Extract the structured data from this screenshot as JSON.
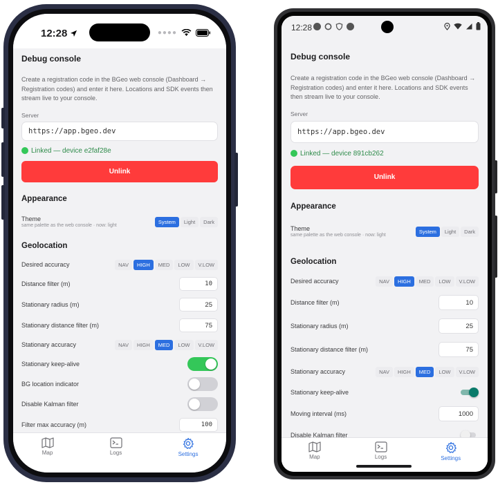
{
  "colors": {
    "accent": "#2c6fe0",
    "danger": "#ff3b3b",
    "success": "#34c759",
    "teal": "#0a7a6a"
  },
  "iphone": {
    "status_time": "12:28",
    "header": "Debug console",
    "description": "Create a registration code in the BGeo web console (Dashboard → Registration codes) and enter it here. Locations and SDK events then stream live to your console.",
    "server_label": "Server",
    "server_value": "https://app.bgeo.dev",
    "linked_text": "Linked — device e2faf28e",
    "unlink_label": "Unlink",
    "appearance_title": "Appearance",
    "theme_label": "Theme",
    "theme_sub": "same palette as the web console · now: light",
    "theme_options": [
      "System",
      "Light",
      "Dark"
    ],
    "theme_selected": 0,
    "geolocation_title": "Geolocation",
    "desired_accuracy_label": "Desired accuracy",
    "accuracy_options": [
      "NAV",
      "HIGH",
      "MED",
      "LOW",
      "V.LOW"
    ],
    "desired_accuracy_selected": 1,
    "distance_filter_label": "Distance filter (m)",
    "distance_filter_value": "10",
    "stationary_radius_label": "Stationary radius (m)",
    "stationary_radius_value": "25",
    "stationary_distance_label": "Stationary distance filter (m)",
    "stationary_distance_value": "75",
    "stationary_accuracy_label": "Stationary accuracy",
    "stationary_accuracy_selected": 2,
    "keepalive_label": "Stationary keep-alive",
    "keepalive_on": true,
    "bg_indicator_label": "BG location indicator",
    "bg_indicator_on": false,
    "kalman_label": "Disable Kalman filter",
    "kalman_on": false,
    "filter_max_label": "Filter max accuracy (m)",
    "filter_max_value": "100",
    "tabs": [
      {
        "label": "Map",
        "icon": "map-icon"
      },
      {
        "label": "Logs",
        "icon": "terminal-icon"
      },
      {
        "label": "Settings",
        "icon": "gear-icon"
      }
    ]
  },
  "android": {
    "status_time": "12:28",
    "header": "Debug console",
    "description": "Create a registration code in the BGeo web console (Dashboard → Registration codes) and enter it here. Locations and SDK events then stream live to your console.",
    "server_label": "Server",
    "server_value": "https://app.bgeo.dev",
    "linked_text": "Linked — device 891cb262",
    "unlink_label": "Unlink",
    "appearance_title": "Appearance",
    "theme_label": "Theme",
    "theme_sub": "same palette as the web console · now: light",
    "theme_options": [
      "System",
      "Light",
      "Dark"
    ],
    "geolocation_title": "Geolocation",
    "desired_accuracy_label": "Desired accuracy",
    "accuracy_options": [
      "NAV",
      "HIGH",
      "MED",
      "LOW",
      "V.LOW"
    ],
    "distance_filter_label": "Distance filter (m)",
    "distance_filter_value": "10",
    "stationary_radius_label": "Stationary radius (m)",
    "stationary_radius_value": "25",
    "stationary_distance_label": "Stationary distance filter (m)",
    "stationary_distance_value": "75",
    "stationary_accuracy_label": "Stationary accuracy",
    "keepalive_label": "Stationary keep-alive",
    "keepalive_on": true,
    "moving_interval_label": "Moving interval (ms)",
    "moving_interval_value": "1000",
    "kalman_label": "Disable Kalman filter",
    "kalman_on": false,
    "tabs": [
      {
        "label": "Map",
        "icon": "map-icon"
      },
      {
        "label": "Logs",
        "icon": "terminal-icon"
      },
      {
        "label": "Settings",
        "icon": "gear-icon"
      }
    ]
  }
}
